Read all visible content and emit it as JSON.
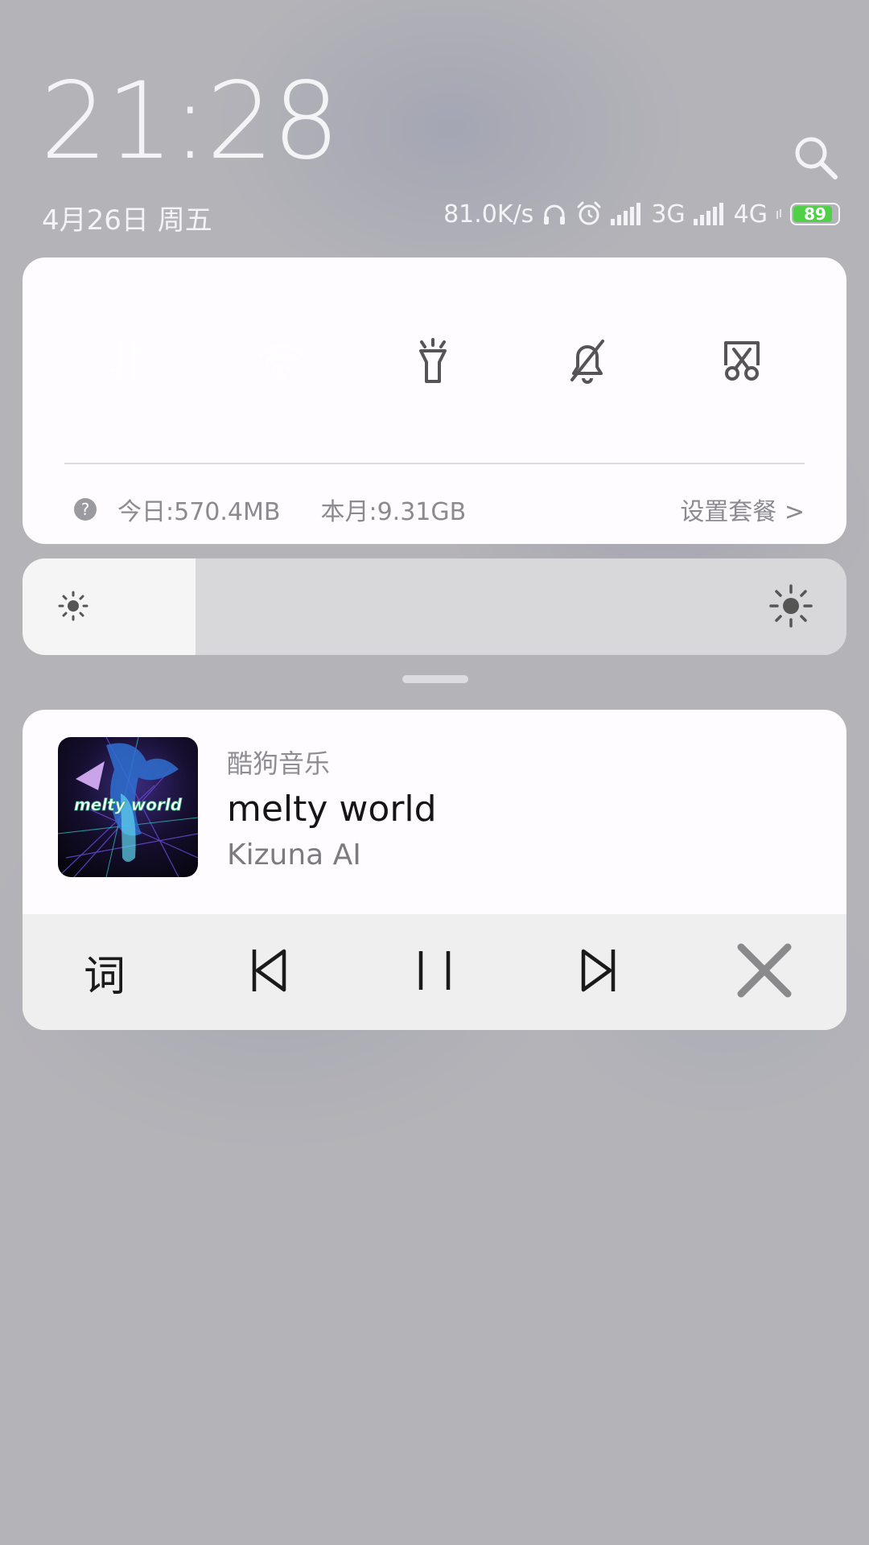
{
  "lockscreen": {
    "time": "21:28",
    "date": "4月26日 周五"
  },
  "status": {
    "net_speed": "81.0K/s",
    "sim1_type": "3G",
    "sim2_type": "4G",
    "battery_percent": 89,
    "battery_label": "89",
    "battery_color": "#4fd046"
  },
  "quick_settings": {
    "toggles": [
      {
        "name": "mobile-data",
        "icon": "data-transfer-icon",
        "on": true
      },
      {
        "name": "wifi",
        "icon": "wifi-icon",
        "on": true
      },
      {
        "name": "flashlight",
        "icon": "flashlight-icon",
        "on": false
      },
      {
        "name": "silent",
        "icon": "bell-off-icon",
        "on": false
      },
      {
        "name": "screenshot",
        "icon": "scissors-icon",
        "on": false
      }
    ],
    "usage_today": "今日:570.4MB",
    "usage_month": "本月:9.31GB",
    "plan_link": "设置套餐 >",
    "help_glyph": "?"
  },
  "brightness": {
    "level": 0.21
  },
  "media": {
    "app": "酷狗音乐",
    "song": "melty  world",
    "artist": "Kizuna AI",
    "album_art_text": "melty world",
    "lyric_label": "词"
  },
  "colors": {
    "accent": "#0a9bf5",
    "card": "#fefcfe",
    "controls_bar": "#efeff0"
  }
}
